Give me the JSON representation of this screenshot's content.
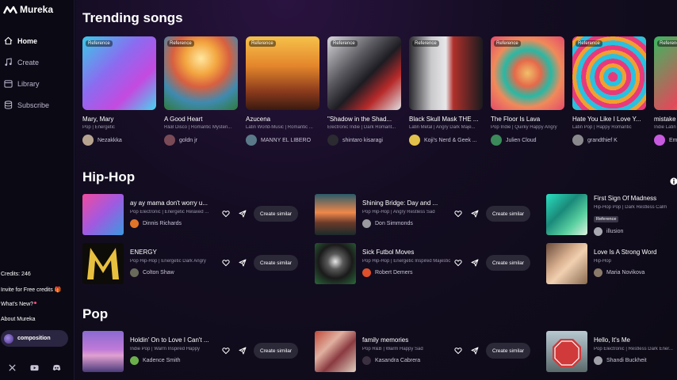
{
  "app": {
    "name": "Mureka"
  },
  "sidebar": {
    "nav": [
      {
        "label": "Home",
        "icon": "home-icon"
      },
      {
        "label": "Create",
        "icon": "music-note-icon"
      },
      {
        "label": "Library",
        "icon": "library-icon"
      },
      {
        "label": "Subscribe",
        "icon": "database-icon"
      }
    ],
    "credits": "Credits: 246",
    "invite": "Invite for Free credits 🎁",
    "whats_new": "What's New?",
    "about": "About Mureka",
    "user": "composition",
    "socials": [
      "x-icon",
      "youtube-icon",
      "discord-icon"
    ]
  },
  "trending": {
    "title": "Trending songs",
    "reference_label": "Reference",
    "cards": [
      {
        "title": "Mary, Mary",
        "genre": "Pop | Energetic",
        "artist": "Nezakkka"
      },
      {
        "title": "A Good Heart",
        "genre": "R&B Disco | Romantic Mysteri...",
        "artist": "goldn jr"
      },
      {
        "title": "Azucena",
        "genre": "Latin World-Music | Romantic ...",
        "artist": "MANNY EL LIBERO"
      },
      {
        "title": "\"Shadow in the Shad...",
        "genre": "Electronic Indie | Dark Romant...",
        "artist": "shintaro kisaragi"
      },
      {
        "title": "Black Skull Mask THE ...",
        "genre": "Latin Metal | Angry Dark Maje...",
        "artist": "Koji's Nerd & Geek ..."
      },
      {
        "title": "The Floor Is Lava",
        "genre": "Pop Indie | Quirky Happy Angry",
        "artist": "Julien Cloud"
      },
      {
        "title": "Hate You Like I Love Y...",
        "genre": "Latin Pop | Happy Romantic",
        "artist": "grandthief K"
      },
      {
        "title": "mistake",
        "genre": "Indie Latin",
        "artist": "Em"
      }
    ]
  },
  "hiphop": {
    "title": "Hip-Hop",
    "songs": [
      {
        "title": "ay ay mama don't worry u...",
        "genre": "Pop Electronic | Energetic Relaxed ...",
        "artist": "Dinnis Richards",
        "button": "Create similar"
      },
      {
        "title": "Shining Bridge: Day and ...",
        "genre": "Pop Hip-Hop | Angry Restless Sad",
        "artist": "Don Simmonds",
        "button": "Create similar"
      },
      {
        "title": "First Sign Of Madness",
        "genre": "Hip-Hop Pop | Dark Restless Calm",
        "badge": "Reference",
        "artist": "illusion"
      },
      {
        "title": "ENERGY",
        "genre": "Pop Hip-Hop | Energetic Dark Angry",
        "artist": "Colton Shaw",
        "button": "Create similar"
      },
      {
        "title": "Sick Futbol Moves",
        "genre": "Pop Hip-Hop | Energetic Inspired Majestic",
        "artist": "Robert Demers",
        "button": "Create similar"
      },
      {
        "title": "Love Is A Strong Word",
        "genre": "Hip-Hop",
        "artist": "Maria Novikova"
      }
    ]
  },
  "pop": {
    "title": "Pop",
    "songs": [
      {
        "title": "Holdin' On to Love I Can't ...",
        "genre": "Indie Pop | Warm Inspired Happy",
        "artist": "Kadence Smith",
        "button": "Create similar"
      },
      {
        "title": "family memories",
        "genre": "Pop R&B | Warm Happy Sad",
        "artist": "Kasandra Cabrera",
        "button": "Create similar"
      },
      {
        "title": "Hello, It's Me",
        "genre": "Pop Electronic | Restless Dark Ener...",
        "artist": "Shandi Buckheit"
      }
    ]
  },
  "colors": {
    "accent": "#7b5cff",
    "background": "#0d0a18",
    "button": "#2b2838"
  }
}
